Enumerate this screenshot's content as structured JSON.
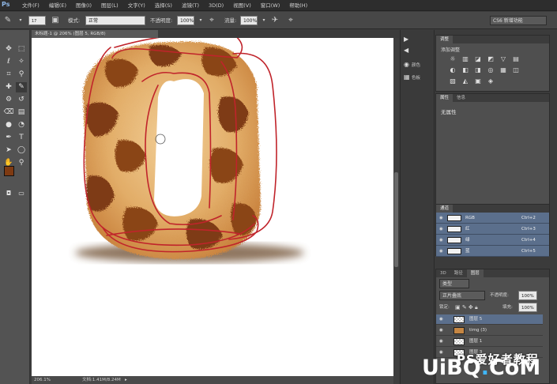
{
  "app": {
    "logo": "Ps"
  },
  "menu": [
    "文件(F)",
    "编辑(E)",
    "图像(I)",
    "图层(L)",
    "文字(Y)",
    "选择(S)",
    "滤镜(T)",
    "3D(D)",
    "视图(V)",
    "窗口(W)",
    "帮助(H)"
  ],
  "options": {
    "brush_size": "17",
    "mode_label": "模式:",
    "mode_value": "正常",
    "opacity_label": "不透明度:",
    "opacity_value": "100%",
    "flow_label": "流量:",
    "flow_value": "100%",
    "workspace": "CS6 新增功能"
  },
  "document": {
    "tab_title": "未标题-1 @ 206% (图层 5, RGB/8)",
    "zoom": "206.1%",
    "doc_info": "文档:1.41M/8.24M"
  },
  "dock": [
    {
      "icon": "▶",
      "label": ""
    },
    {
      "icon": "◀",
      "label": ""
    },
    {
      "icon": "◉",
      "label": "颜色"
    },
    {
      "icon": "▦",
      "label": "色板"
    }
  ],
  "adjust_panel": {
    "tab": "调整",
    "title": "添加调整",
    "icons": [
      "☼",
      "▥",
      "◪",
      "◩",
      "▽",
      "▤",
      "◐",
      "◧",
      "◨",
      "◎",
      "▦",
      "◫",
      "▨",
      "◭",
      "▣",
      "◈"
    ]
  },
  "properties_panel": {
    "tabs": [
      "属性",
      "信息"
    ],
    "content": "无属性"
  },
  "channels_panel": {
    "tab": "通道",
    "rows": [
      {
        "name": "RGB",
        "key": "Ctrl+2"
      },
      {
        "name": "红",
        "key": "Ctrl+3"
      },
      {
        "name": "绿",
        "key": "Ctrl+4"
      },
      {
        "name": "蓝",
        "key": "Ctrl+5"
      }
    ]
  },
  "layers_panel": {
    "tabs": [
      "3D",
      "路径",
      "图层"
    ],
    "filter": "类型",
    "blend_mode": "正片叠底",
    "opacity_label": "不透明度:",
    "opacity_value": "100%",
    "lock_label": "锁定:",
    "fill_label": "填充:",
    "fill_value": "100%",
    "layers": [
      {
        "name": "图层 5",
        "selected": true
      },
      {
        "name": "timg (3)",
        "selected": false
      },
      {
        "name": "图层 1",
        "selected": false
      },
      {
        "name": "图层 3",
        "selected": false
      }
    ]
  },
  "watermark": {
    "chinese": "PS爱好者教程",
    "url_main": "UiBQ",
    "url_dot": ".",
    "url_end": "CoM"
  },
  "colors": {
    "annotation": "#c0242b",
    "fur_light": "#e6b777",
    "fur_dark": "#7e3a12",
    "accent_row": "#5b6f8c"
  }
}
